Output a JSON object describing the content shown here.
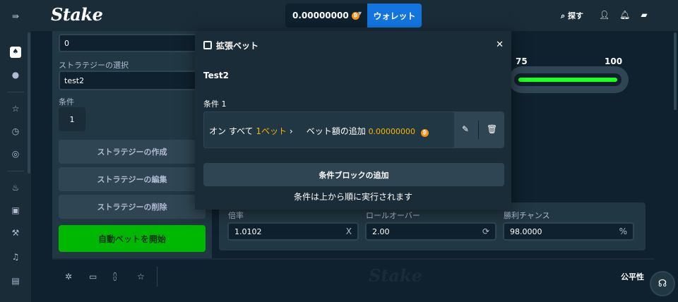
{
  "header": {
    "logo": "Stake",
    "balance": "0.00000000",
    "balance_chevron": "▾",
    "wallet_label": "ウォレット",
    "search_label": "探す",
    "icons": [
      "search-icon",
      "user-icon",
      "bell-icon",
      "chat-icon"
    ]
  },
  "rail": {
    "icons": [
      "expand-icon",
      "casino-icon",
      "sports-icon",
      "favorites-icon",
      "recent-icon",
      "challenges-icon",
      "hot-icon",
      "bookmark-icon",
      "originals-icon",
      "live-support-icon",
      "gift-icon"
    ]
  },
  "game_sidebar": {
    "amount_value": "0",
    "strategy_label": "ストラテジーの選択",
    "strategy_value": "test2",
    "condition_label": "条件",
    "condition_count": "1",
    "create_label": "ストラテジーの作成",
    "edit_label": "ストラテジーの編集",
    "delete_label": "ストラテジーの削除",
    "autobet_label": "自動ベットを開始"
  },
  "slider": {
    "tick_75": "75",
    "tick_100": "100",
    "level_percent": 98
  },
  "stats": {
    "multiplier_label": "倍率",
    "multiplier_value": "1.0102",
    "multiplier_suffix": "X",
    "rollover_label": "ロールオーバー",
    "rollover_value": "2.00",
    "chance_label": "勝利チャンス",
    "chance_value": "98.0000",
    "chance_suffix": "%"
  },
  "footer": {
    "logo": "Stake",
    "fairness_label": "公平性"
  },
  "modal": {
    "title": "拡張ベット",
    "strategy_name": "Test2",
    "condition_label": "条件 1",
    "condition": {
      "on": "オン",
      "every": "すべて",
      "count": "1ベット",
      "arrow": "›",
      "action": "ベット額の追加",
      "amount": "0.00000000"
    },
    "add_block_label": "条件ブロックの追加",
    "exec_note": "条件は上から順に実行されます"
  },
  "colors": {
    "bg": "#0f212e",
    "panel": "#213743",
    "topbar": "#1a2c38",
    "accent_blue": "#1475e1",
    "accent_green": "#00b801",
    "gold": "#f7b500"
  }
}
